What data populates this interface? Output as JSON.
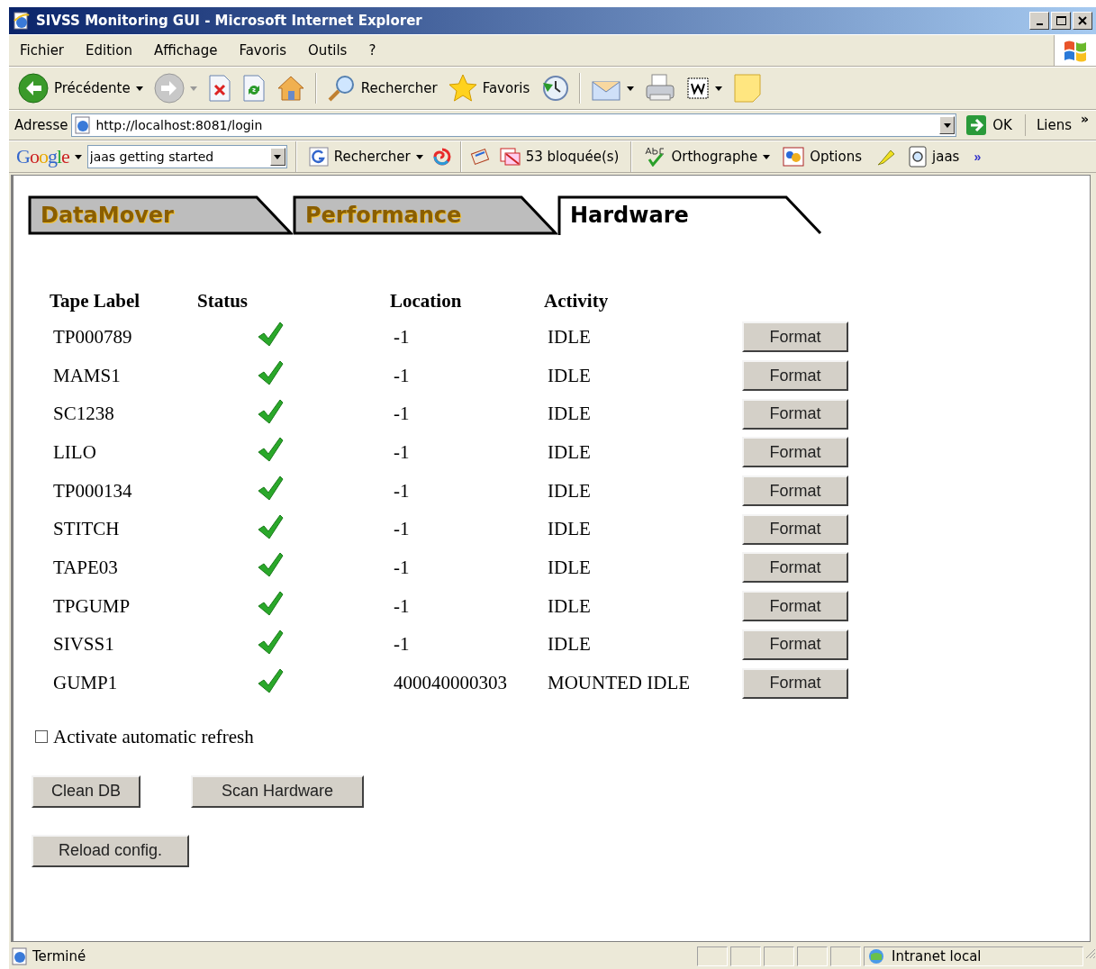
{
  "window": {
    "title": "SIVSS Monitoring GUI - Microsoft Internet Explorer"
  },
  "menu": [
    {
      "label": "Fichier"
    },
    {
      "label": "Edition"
    },
    {
      "label": "Affichage"
    },
    {
      "label": "Favoris"
    },
    {
      "label": "Outils"
    },
    {
      "label": "?"
    }
  ],
  "toolbar": [
    {
      "kind": "back",
      "label": "Précédente",
      "dropdown": true,
      "disabled": false
    },
    {
      "kind": "forward",
      "dropdown": true,
      "disabled": true
    },
    {
      "kind": "stop"
    },
    {
      "kind": "refresh"
    },
    {
      "kind": "home"
    },
    {
      "kind": "separator"
    },
    {
      "kind": "search",
      "label": "Rechercher"
    },
    {
      "kind": "favorites",
      "label": "Favoris"
    },
    {
      "kind": "history"
    },
    {
      "kind": "separator"
    },
    {
      "kind": "mail",
      "dropdown": true
    },
    {
      "kind": "print"
    },
    {
      "kind": "word",
      "dropdown": true
    },
    {
      "kind": "note"
    }
  ],
  "address": {
    "label": "Adresse",
    "url": "http://localhost:8081/login",
    "go": "OK",
    "links": "Liens",
    "more": "»"
  },
  "google_bar": {
    "logo": "Google",
    "query": "jaas getting started",
    "search": "Rechercher",
    "blocked": "53 bloquée(s)",
    "spell": "Orthographe",
    "options": "Options",
    "word": "jaas",
    "more": "»"
  },
  "tabs": [
    {
      "label": "DataMover",
      "selected": false
    },
    {
      "label": "Performance",
      "selected": false
    },
    {
      "label": "Hardware",
      "selected": true
    }
  ],
  "table": {
    "columns": [
      "Tape Label",
      "Status",
      "Location",
      "Activity"
    ],
    "rows": [
      {
        "label": "TP000789",
        "ok": true,
        "location": "-1",
        "activity": "IDLE",
        "action": "Format"
      },
      {
        "label": "MAMS1",
        "ok": true,
        "location": "-1",
        "activity": "IDLE",
        "action": "Format"
      },
      {
        "label": "SC1238",
        "ok": true,
        "location": "-1",
        "activity": "IDLE",
        "action": "Format"
      },
      {
        "label": "LILO",
        "ok": true,
        "location": "-1",
        "activity": "IDLE",
        "action": "Format"
      },
      {
        "label": "TP000134",
        "ok": true,
        "location": "-1",
        "activity": "IDLE",
        "action": "Format"
      },
      {
        "label": "STITCH",
        "ok": true,
        "location": "-1",
        "activity": "IDLE",
        "action": "Format"
      },
      {
        "label": "TAPE03",
        "ok": true,
        "location": "-1",
        "activity": "IDLE",
        "action": "Format"
      },
      {
        "label": "TPGUMP",
        "ok": true,
        "location": "-1",
        "activity": "IDLE",
        "action": "Format"
      },
      {
        "label": "SIVSS1",
        "ok": true,
        "location": "-1",
        "activity": "IDLE",
        "action": "Format"
      },
      {
        "label": "GUMP1",
        "ok": true,
        "location": "400040000303",
        "activity": "MOUNTED IDLE",
        "action": "Format"
      }
    ]
  },
  "auto_refresh": {
    "label": "Activate automatic refresh",
    "checked": false
  },
  "buttons": [
    [
      "Clean DB",
      "Scan Hardware"
    ],
    [
      "Reload config."
    ]
  ],
  "status_bar": {
    "text": "Terminé",
    "zone": "Intranet local"
  }
}
